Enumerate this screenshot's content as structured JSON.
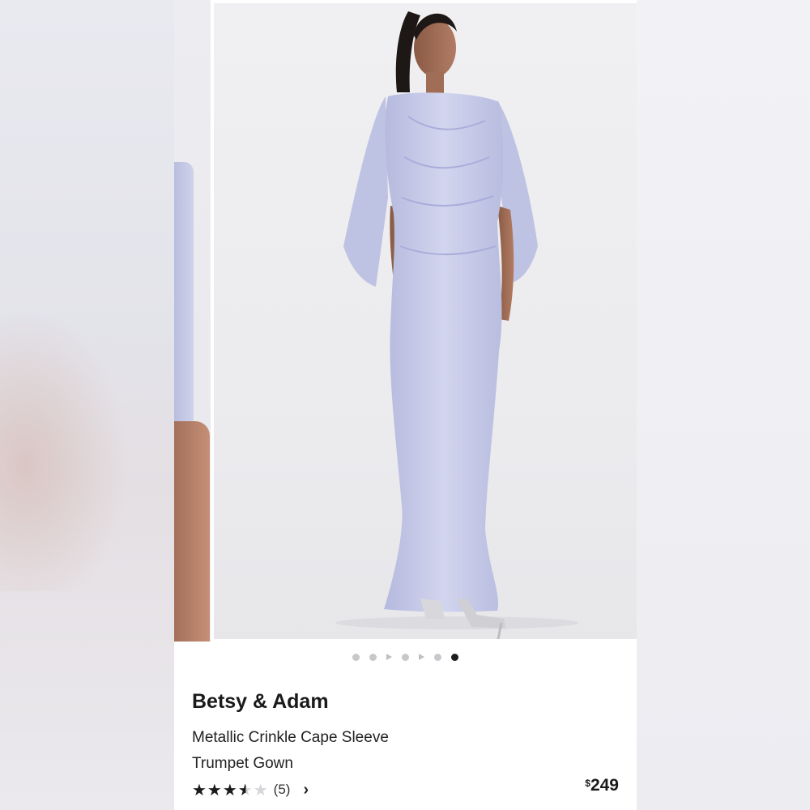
{
  "gallery": {
    "image_count": 7,
    "active_index": 6,
    "indicators": [
      "dot",
      "dot",
      "play",
      "dot",
      "play",
      "dot",
      "dot"
    ]
  },
  "product": {
    "brand": "Betsy & Adam",
    "name_line1": "Metallic Crinkle Cape Sleeve",
    "name_line2": "Trumpet Gown",
    "rating": 3.5,
    "review_count": "(5)",
    "currency": "$",
    "price": "249"
  },
  "colors": {
    "gown": "#c5c8e6",
    "text": "#1a1a1a"
  }
}
